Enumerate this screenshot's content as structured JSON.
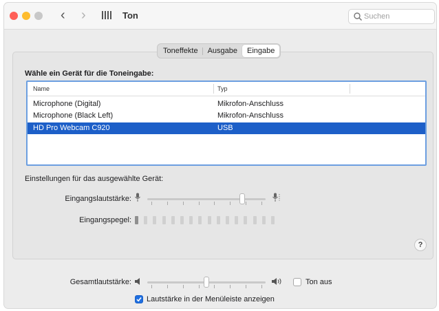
{
  "window": {
    "title": "Ton"
  },
  "search": {
    "placeholder": "Suchen"
  },
  "tabs": [
    {
      "label": "Toneffekte",
      "active": false
    },
    {
      "label": "Ausgabe",
      "active": false
    },
    {
      "label": "Eingabe",
      "active": true
    }
  ],
  "input": {
    "section_title": "Wähle ein Gerät für die Toneingabe:",
    "columns": {
      "name": "Name",
      "type": "Typ"
    },
    "devices": [
      {
        "name": "Microphone (Digital)",
        "type": "Mikrofon-Anschluss",
        "selected": false
      },
      {
        "name": "Microphone (Black Left)",
        "type": "Mikrofon-Anschluss",
        "selected": false
      },
      {
        "name": "HD Pro Webcam C920",
        "type": "USB",
        "selected": true
      }
    ],
    "settings_title": "Einstellungen für das ausgewählte Gerät:",
    "input_volume": {
      "label": "Eingangslautstärke:",
      "level": 0.8
    },
    "input_level": {
      "label": "Eingangspegel:",
      "active_bars": 1,
      "total_bars": 16
    }
  },
  "help": {
    "label": "?"
  },
  "output": {
    "volume_label": "Gesamtlautstärke:",
    "volume_level": 0.5,
    "mute_label": "Ton aus",
    "mute_checked": false,
    "menubar_label": "Lautstärke in der Menüleiste anzeigen",
    "menubar_checked": true
  },
  "colors": {
    "accent": "#1f6fe0",
    "selection": "#1d5fc8",
    "focus_ring": "#6b9ee0",
    "close": "#ff5f57",
    "minimize": "#febc2e"
  },
  "icons": [
    "back-chevron-icon",
    "forward-chevron-icon",
    "show-all-grid-icon",
    "search-icon",
    "microphone-icon",
    "speaker-icon",
    "checkmark-icon"
  ]
}
